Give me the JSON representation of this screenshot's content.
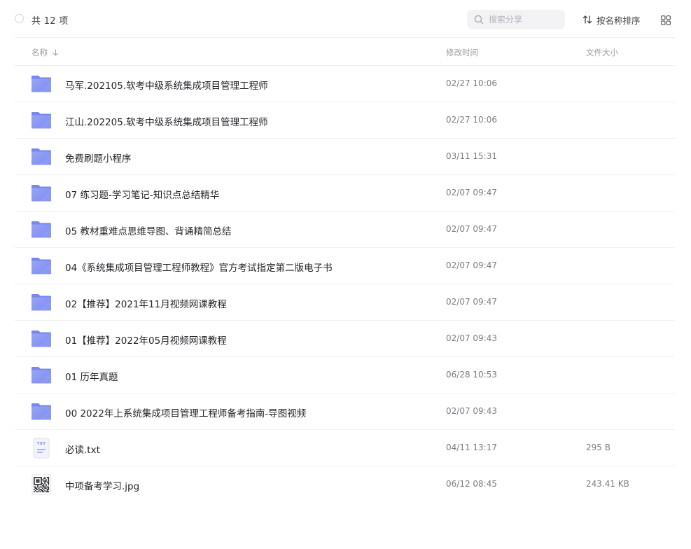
{
  "toolbar": {
    "count_label": "共 12 项",
    "search_placeholder": "搜索分享",
    "sort_label": "按名称排序"
  },
  "columns": {
    "name": "名称",
    "modified": "修改时间",
    "size": "文件大小"
  },
  "colors": {
    "folder_front": "#8d9bf5",
    "folder_back": "#7a88ef",
    "divider": "#efeff1",
    "muted_text": "#9a9ba2"
  },
  "files": [
    {
      "type": "folder",
      "icon": "folder-icon",
      "name": "马军.202105.软考中级系统集成项目管理工程师",
      "modified": "02/27 10:06",
      "size": ""
    },
    {
      "type": "folder",
      "icon": "folder-icon",
      "name": "江山.202205.软考中级系统集成项目管理工程师",
      "modified": "02/27 10:06",
      "size": ""
    },
    {
      "type": "folder",
      "icon": "folder-icon",
      "name": "免费刷题小程序",
      "modified": "03/11 15:31",
      "size": ""
    },
    {
      "type": "folder",
      "icon": "folder-icon",
      "name": "07 练习题-学习笔记-知识点总结精华",
      "modified": "02/07 09:47",
      "size": ""
    },
    {
      "type": "folder",
      "icon": "folder-icon",
      "name": "05 教材重难点思维导图、背诵精简总结",
      "modified": "02/07 09:47",
      "size": ""
    },
    {
      "type": "folder",
      "icon": "folder-icon",
      "name": "04《系统集成项目管理工程师教程》官方考试指定第二版电子书",
      "modified": "02/07 09:47",
      "size": ""
    },
    {
      "type": "folder",
      "icon": "folder-icon",
      "name": "02【推荐】2021年11月视频网课教程",
      "modified": "02/07 09:47",
      "size": ""
    },
    {
      "type": "folder",
      "icon": "folder-icon",
      "name": "01【推荐】2022年05月视频网课教程",
      "modified": "02/07 09:43",
      "size": ""
    },
    {
      "type": "folder",
      "icon": "folder-icon",
      "name": "01 历年真题",
      "modified": "06/28 10:53",
      "size": ""
    },
    {
      "type": "folder",
      "icon": "folder-icon",
      "name": "00 2022年上系统集成项目管理工程师备考指南-导图视频",
      "modified": "02/07 09:43",
      "size": ""
    },
    {
      "type": "txt",
      "icon": "txt-file-icon",
      "icon_text": "TXT",
      "name": "必读.txt",
      "modified": "04/11 13:17",
      "size": "295 B"
    },
    {
      "type": "image",
      "icon": "qr-image-icon",
      "name": "中项备考学习.jpg",
      "modified": "06/12 08:45",
      "size": "243.41 KB"
    }
  ]
}
